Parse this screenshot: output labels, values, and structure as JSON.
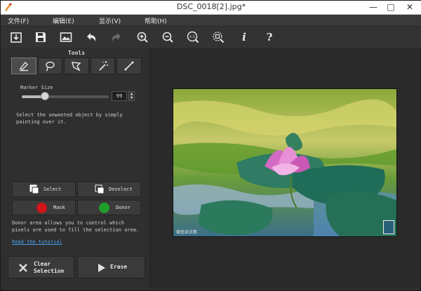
{
  "window": {
    "title": "DSC_0018[2].jpg*"
  },
  "menu": [
    "文件(F)",
    "编辑(E)",
    "显示(V)",
    "帮助(H)"
  ],
  "toolbar": {
    "buttons": [
      "open-icon",
      "save-icon",
      "image-icon",
      "undo-icon",
      "redo-icon",
      "zoom-in-icon",
      "zoom-out-icon",
      "zoom-actual-icon",
      "zoom-fit-icon",
      "info-icon",
      "help-icon"
    ],
    "actual_label": "1:1",
    "info_label": "i",
    "help_label": "?"
  },
  "tools": {
    "label": "Tools",
    "items": [
      "marker-icon",
      "lasso-icon",
      "polygon-lasso-icon",
      "magic-wand-icon",
      "line-icon"
    ],
    "active": "marker-icon"
  },
  "marker": {
    "label": "Marker Size",
    "value": "99",
    "slider_fraction": 0.27
  },
  "hint": "Select the unwanted object by simply painting over it.",
  "selection": {
    "select_label": "Select",
    "deselect_label": "Deselect",
    "mask_label": "Mask",
    "donor_label": "Donor",
    "mask_color": "#d0161a",
    "donor_color": "#1f9e2a"
  },
  "donor_note": "Donor area allows you to control which pixels are used to fill the selection area.",
  "tutorial_link": "Read the tutorial",
  "actions": {
    "clear_label": "Clear\nSelection",
    "erase_label": "Erase"
  },
  "photo": {
    "watermark_text": "微信采访笔",
    "seal_text": ""
  }
}
